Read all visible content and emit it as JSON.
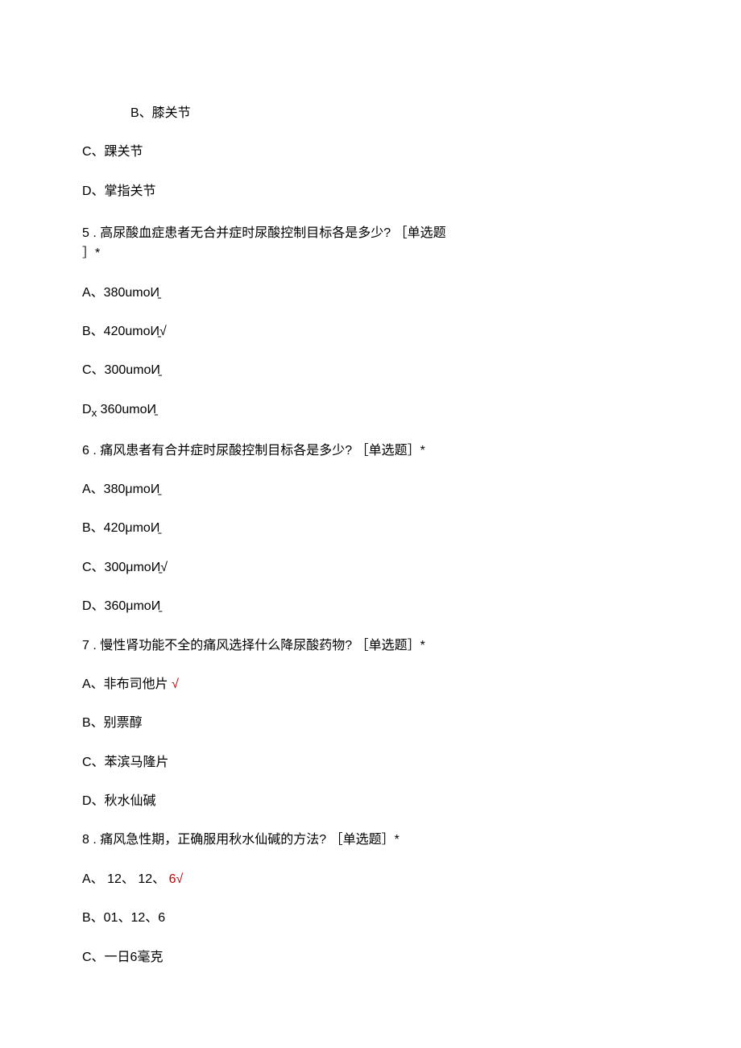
{
  "lines": {
    "opt_b_knee": "B、膝关节",
    "opt_c_ankle": "C、踝关节",
    "opt_d_mcp": "D、掌指关节",
    "q5_l1": "5  . 高尿酸血症患者无合并症时尿酸控制目标各是多少? ［单选题",
    "q5_l2": "］*",
    "q5_a": "A、380umoИ̱",
    "q5_b": "B、420umoИ̱√",
    "q5_c": "C、300umoИ̱",
    "q5_d_pre": "D",
    "q5_d_sub": "x",
    "q5_d_post": " 360umoИ̱",
    "q6": "6  . 痛风患者有合并症时尿酸控制目标各是多少? ［单选题］*",
    "q6_a": "A、380μmoИ̱",
    "q6_b": "B、420μmoИ̱",
    "q6_c": "C、300μmoИ̱√",
    "q6_d": "D、360μmoИ̱",
    "q7": "7  . 慢性肾功能不全的痛风选择什么降尿酸药物? ［单选题］*",
    "q7_a_black": "A、非布司他片 ",
    "q7_a_red": "√",
    "q7_b": "B、别票醇",
    "q7_c": "C、苯滨马隆片",
    "q7_d": "D、秋水仙碱",
    "q8": "8  . 痛风急性期，正确服用秋水仙碱的方法? ［单选题］*",
    "q8_a_black": "A、  12、  12、  ",
    "q8_a_red": "6√",
    "q8_b": "B、01、12、6",
    "q8_c": "C、一日6毫克"
  }
}
